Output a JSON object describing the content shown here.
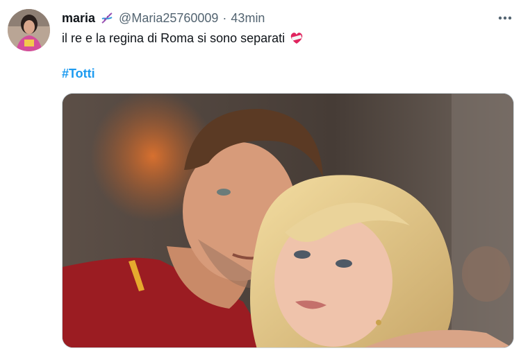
{
  "author": {
    "display_name": "maria",
    "handle": "@Maria25760009",
    "separator": "·",
    "time": "43min",
    "badge_icon": "dna-icon",
    "avatar_icon": "avatar"
  },
  "tweet": {
    "text": "il re e la regina di Roma si sono separati",
    "emoji_icon": "mending-heart-icon",
    "hashtag": "#Totti"
  },
  "actions": {
    "more_icon": "more-options-icon"
  },
  "colors": {
    "link": "#1d9bf0",
    "secondary_text": "#536471",
    "primary_text": "#0f1419",
    "border": "#cfd9de"
  }
}
